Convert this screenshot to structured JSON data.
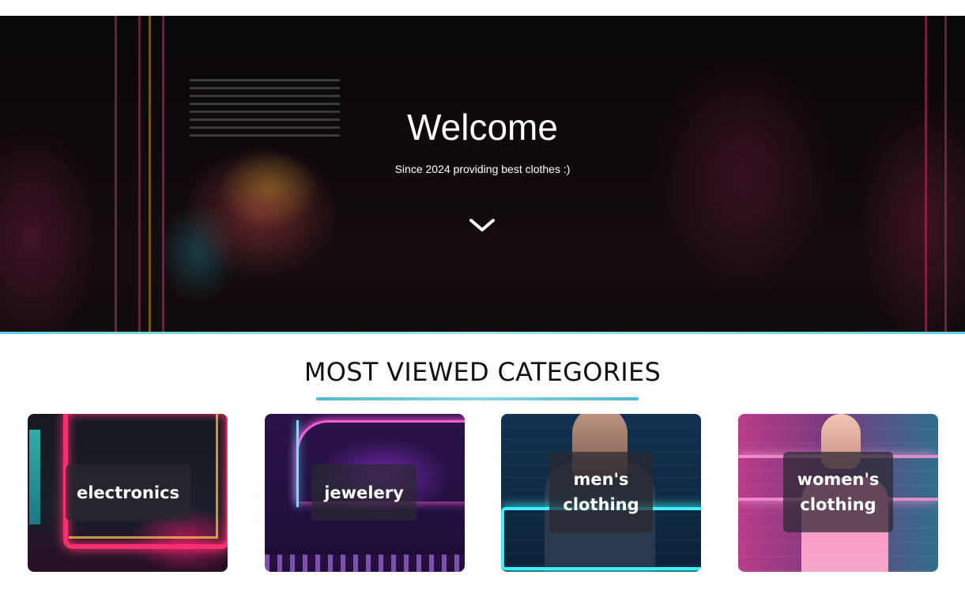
{
  "hero": {
    "title": "Welcome",
    "subtitle": "Since 2024 providing best clothes :)",
    "scroll_icon": "chevron-down-icon",
    "border_color": "#62d3e6"
  },
  "section": {
    "title": "MOST VIEWED CATEGORIES",
    "underline_color": "#4fb8cf"
  },
  "categories": [
    {
      "label_line1": "electronics",
      "label_line2": ""
    },
    {
      "label_line1": "jewelery",
      "label_line2": ""
    },
    {
      "label_line1": "men's",
      "label_line2": "clothing"
    },
    {
      "label_line1": "women's",
      "label_line2": "clothing"
    }
  ]
}
